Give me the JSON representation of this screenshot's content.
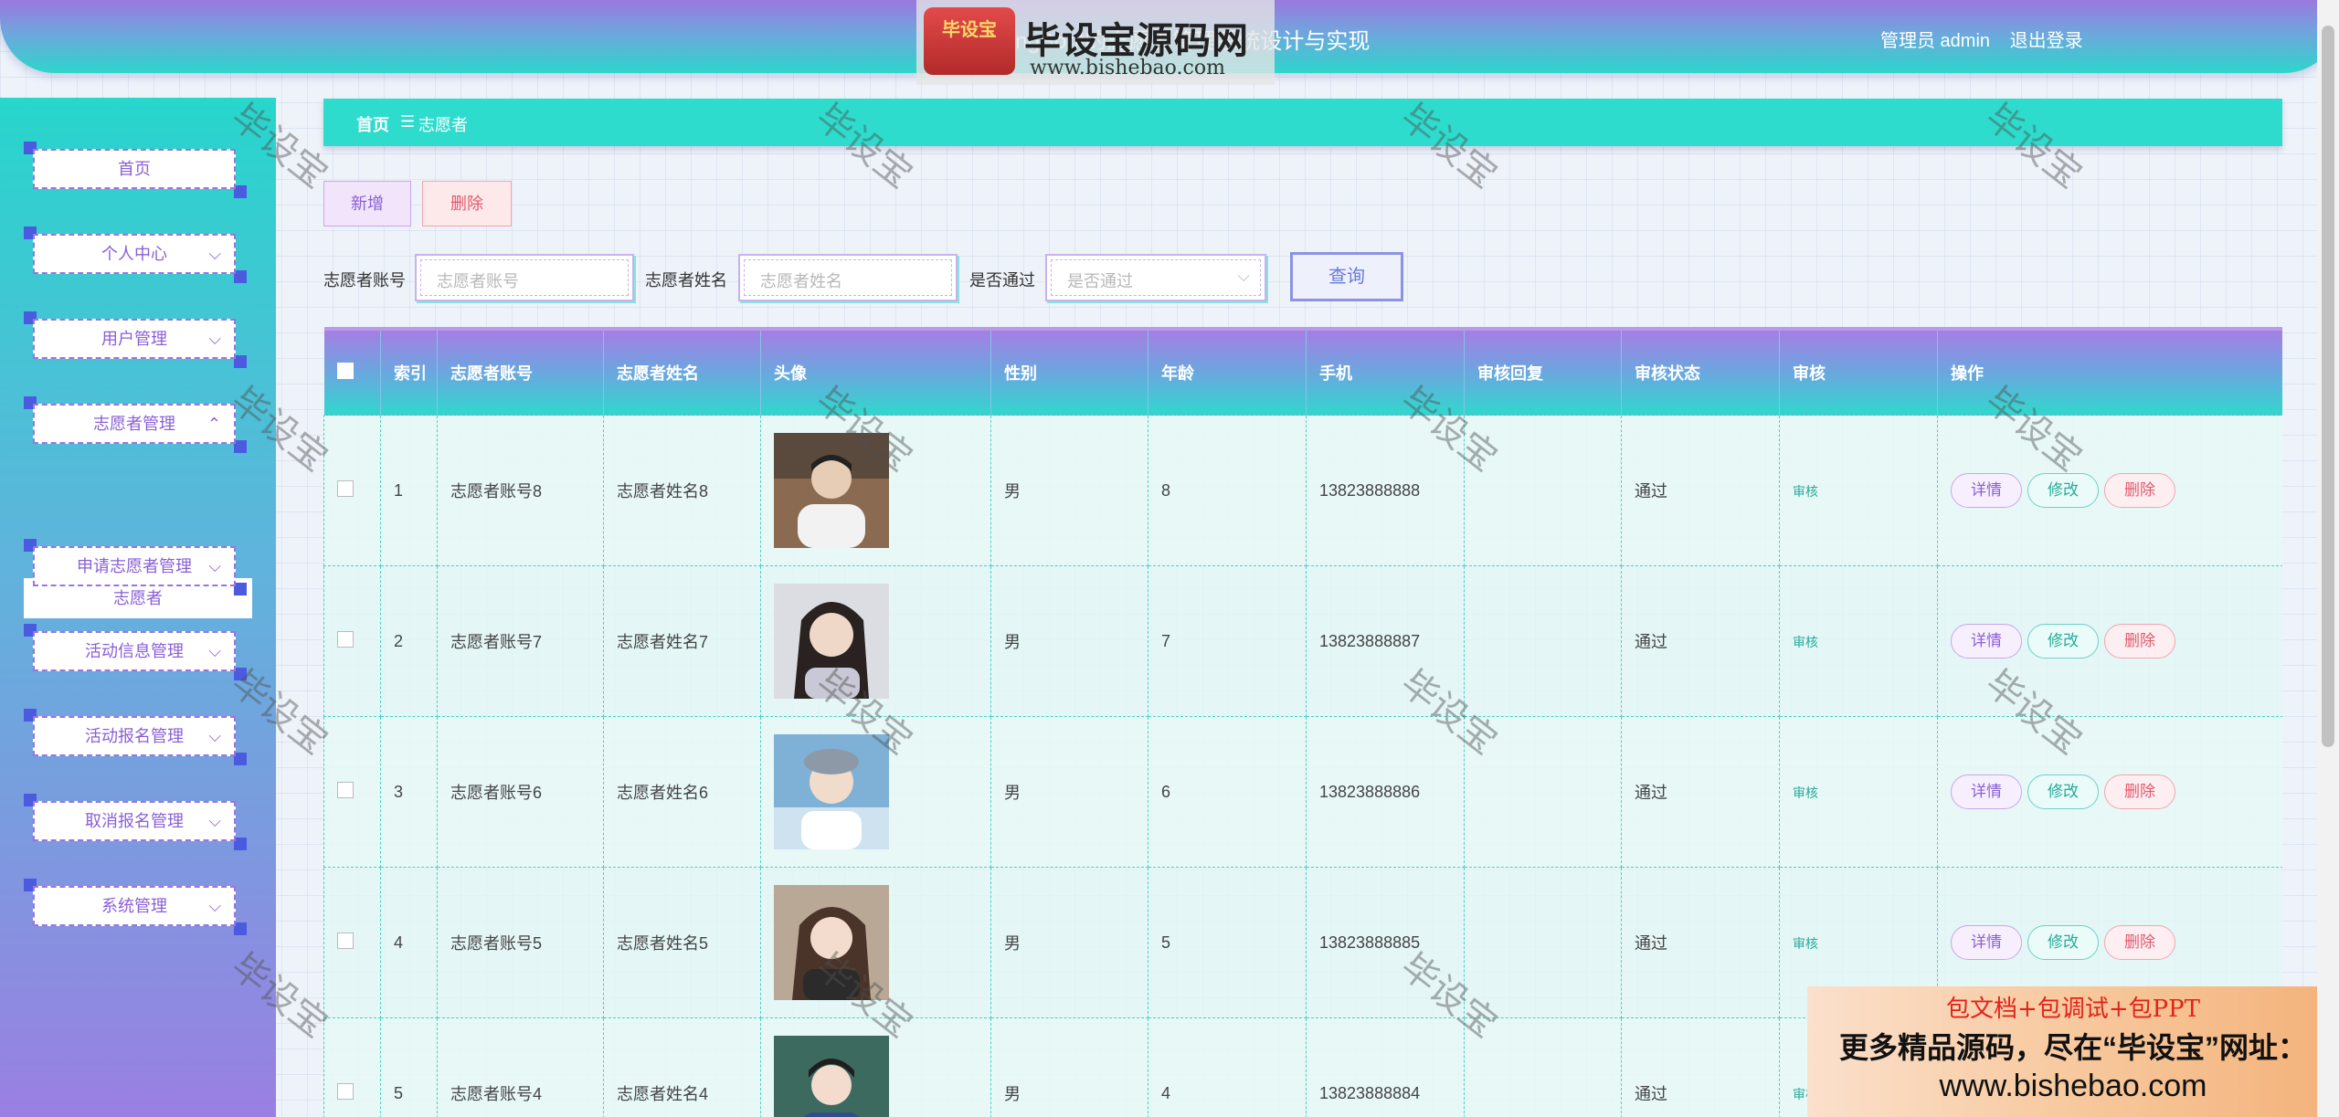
{
  "header": {
    "title": "基于SpringBoot的志愿者管理系统设计与实现",
    "logo_badge": "毕设宝",
    "logo_text": "毕设宝源码网",
    "logo_url": "www.bishebao.com",
    "admin_label": "管理员 admin",
    "logout_label": "退出登录"
  },
  "sidebar": {
    "items": [
      {
        "label": "首页"
      },
      {
        "label": "个人中心"
      },
      {
        "label": "用户管理"
      },
      {
        "label": "志愿者管理"
      },
      {
        "label": "申请志愿者管理"
      },
      {
        "label": "活动信息管理"
      },
      {
        "label": "活动报名管理"
      },
      {
        "label": "取消报名管理"
      },
      {
        "label": "系统管理"
      }
    ],
    "active_sub": "志愿者",
    "chevrons": {
      "down": "⌵",
      "up": "⌃"
    }
  },
  "breadcrumb": {
    "home": "首页",
    "sep": "☰",
    "current": "志愿者"
  },
  "actions": {
    "add": "新增",
    "delete": "删除"
  },
  "search": {
    "account_label": "志愿者账号",
    "account_placeholder": "志愿者账号",
    "name_label": "志愿者姓名",
    "name_placeholder": "志愿者姓名",
    "pass_label": "是否通过",
    "pass_placeholder": "是否通过",
    "query_button": "查询"
  },
  "table": {
    "headers": {
      "index": "索引",
      "account": "志愿者账号",
      "name": "志愿者姓名",
      "avatar": "头像",
      "gender": "性别",
      "age": "年龄",
      "phone": "手机",
      "reply": "审核回复",
      "status": "审核状态",
      "audit": "审核",
      "ops": "操作"
    },
    "rows": [
      {
        "index": "1",
        "account": "志愿者账号8",
        "name": "志愿者姓名8",
        "gender": "男",
        "age": "8",
        "phone": "13823888888",
        "reply": "",
        "status": "通过",
        "audit": "审核"
      },
      {
        "index": "2",
        "account": "志愿者账号7",
        "name": "志愿者姓名7",
        "gender": "男",
        "age": "7",
        "phone": "13823888887",
        "reply": "",
        "status": "通过",
        "audit": "审核"
      },
      {
        "index": "3",
        "account": "志愿者账号6",
        "name": "志愿者姓名6",
        "gender": "男",
        "age": "6",
        "phone": "13823888886",
        "reply": "",
        "status": "通过",
        "audit": "审核"
      },
      {
        "index": "4",
        "account": "志愿者账号5",
        "name": "志愿者姓名5",
        "gender": "男",
        "age": "5",
        "phone": "13823888885",
        "reply": "",
        "status": "通过",
        "audit": "审核"
      },
      {
        "index": "5",
        "account": "志愿者账号4",
        "name": "志愿者姓名4",
        "gender": "男",
        "age": "4",
        "phone": "13823888884",
        "reply": "",
        "status": "通过",
        "audit": "审核"
      }
    ],
    "op_labels": {
      "detail": "详情",
      "edit": "修改",
      "delete": "删除"
    }
  },
  "watermark": "毕设宝",
  "promo": {
    "line1": "包文档+包调试+包PPT",
    "line2": "更多精品源码，尽在“毕设宝”网址：",
    "line3": "www.bishebao.com"
  },
  "colors": {
    "accent_teal": "#2ddccd",
    "accent_purple": "#9a78e0",
    "delete_red": "#e05a6e"
  }
}
